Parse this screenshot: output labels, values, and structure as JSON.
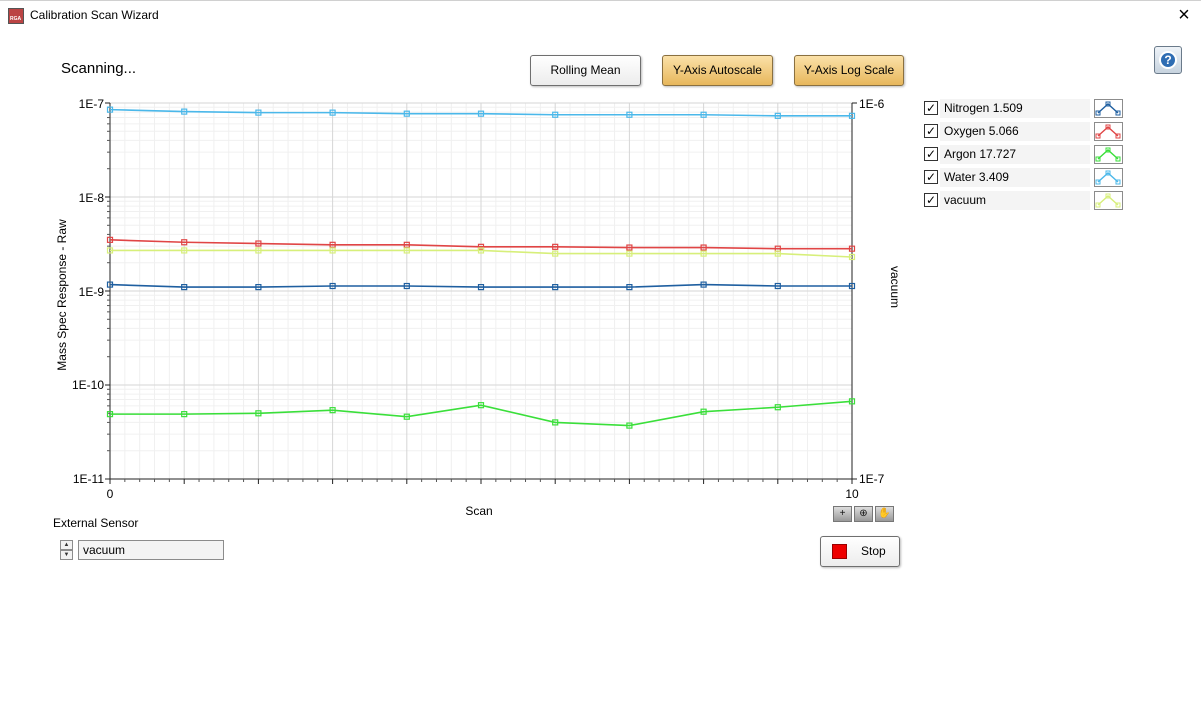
{
  "window": {
    "title": "Calibration Scan Wizard",
    "icon_text": "RGA"
  },
  "status": "Scanning...",
  "toolbar": {
    "rolling_mean": "Rolling Mean",
    "autoscale": "Y-Axis Autoscale",
    "log_scale": "Y-Axis Log Scale"
  },
  "legend": [
    {
      "label": "Nitrogen 1.509",
      "checked": true,
      "color": "#1f5fa0"
    },
    {
      "label": "Oxygen 5.066",
      "checked": true,
      "color": "#e04545"
    },
    {
      "label": "Argon 17.727",
      "checked": true,
      "color": "#3adf3a"
    },
    {
      "label": "Water 3.409",
      "checked": true,
      "color": "#4bb8ea"
    },
    {
      "label": "vacuum",
      "checked": true,
      "color": "#d7ef7a"
    }
  ],
  "sensor": {
    "label": "External Sensor",
    "value": "vacuum"
  },
  "stop": {
    "label": "Stop"
  },
  "chart_data": {
    "type": "line",
    "xlabel": "Scan",
    "ylabel": "Mass Spec Response - Raw",
    "y2label": "vacuum",
    "y_scale": "log",
    "xlim": [
      0,
      10
    ],
    "ylim": [
      1e-11,
      1e-07
    ],
    "y2lim": [
      1e-07,
      1e-06
    ],
    "x_tick_labels": [
      "0",
      "10"
    ],
    "y_tick_labels": [
      "1E-7",
      "1E-8",
      "1E-9",
      "1E-10",
      "1E-11"
    ],
    "y2_tick_labels": [
      "1E-6",
      "1E-7"
    ],
    "grid": true,
    "x": [
      0,
      1,
      2,
      3,
      4,
      5,
      6,
      7,
      8,
      9,
      10
    ],
    "series": [
      {
        "name": "Nitrogen 1.509",
        "color": "#1f5fa0",
        "axis": "left",
        "values": [
          1.17e-09,
          1.1e-09,
          1.1e-09,
          1.13e-09,
          1.13e-09,
          1.1e-09,
          1.1e-09,
          1.1e-09,
          1.17e-09,
          1.13e-09,
          1.13e-09
        ]
      },
      {
        "name": "Oxygen 5.066",
        "color": "#e04545",
        "axis": "left",
        "values": [
          3.5e-09,
          3.3e-09,
          3.2e-09,
          3.1e-09,
          3.1e-09,
          2.95e-09,
          2.95e-09,
          2.9e-09,
          2.9e-09,
          2.82e-09,
          2.82e-09
        ]
      },
      {
        "name": "Argon 17.727",
        "color": "#3adf3a",
        "axis": "left",
        "values": [
          4.9e-11,
          4.9e-11,
          5e-11,
          5.4e-11,
          4.6e-11,
          6.1e-11,
          4e-11,
          3.7e-11,
          5.2e-11,
          5.8e-11,
          6.7e-11
        ]
      },
      {
        "name": "Water 3.409",
        "color": "#4bb8ea",
        "axis": "left",
        "values": [
          8.5e-08,
          8.1e-08,
          7.9e-08,
          7.9e-08,
          7.7e-08,
          7.7e-08,
          7.5e-08,
          7.5e-08,
          7.5e-08,
          7.3e-08,
          7.3e-08
        ]
      },
      {
        "name": "vacuum",
        "color": "#d7ef7a",
        "axis": "left",
        "values": [
          2.7e-09,
          2.7e-09,
          2.7e-09,
          2.7e-09,
          2.7e-09,
          2.7e-09,
          2.5e-09,
          2.5e-09,
          2.5e-09,
          2.5e-09,
          2.3e-09
        ]
      }
    ]
  }
}
